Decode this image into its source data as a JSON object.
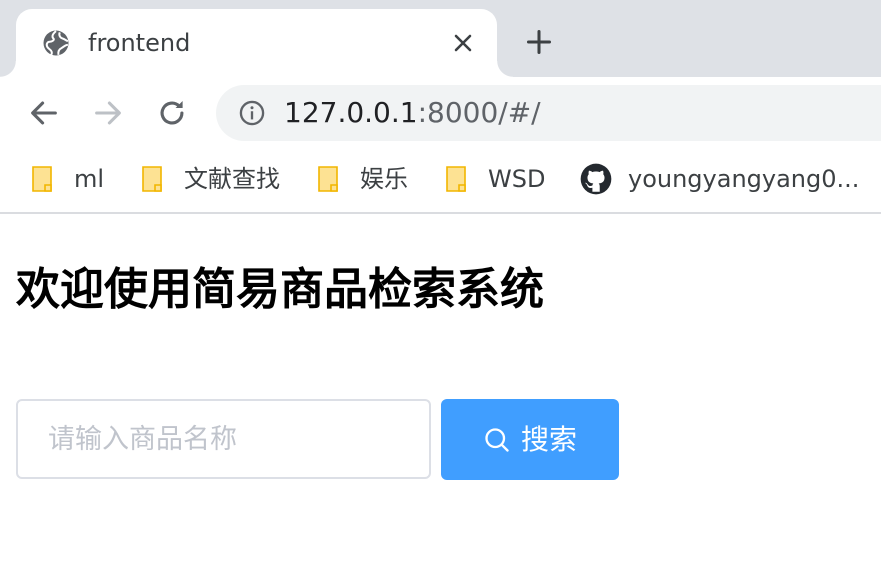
{
  "browser": {
    "tab": {
      "title": "frontend",
      "favicon": "globe-icon",
      "close_icon": "close-icon"
    },
    "new_tab_icon": "plus-icon",
    "toolbar": {
      "back_icon": "arrow-back-icon",
      "forward_icon": "arrow-forward-icon",
      "reload_icon": "reload-icon",
      "info_icon": "info-icon",
      "url_host": "127.0.0.1",
      "url_rest": ":8000/#/"
    },
    "bookmarks": [
      {
        "label": "ml",
        "icon": "folder-icon"
      },
      {
        "label": "文献查找",
        "icon": "folder-icon"
      },
      {
        "label": "娱乐",
        "icon": "folder-icon"
      },
      {
        "label": "WSD",
        "icon": "folder-icon"
      },
      {
        "label": "youngyangyang0...",
        "icon": "github-icon"
      }
    ]
  },
  "page": {
    "title": "欢迎使用简易商品检索系统",
    "search": {
      "placeholder": "请输入商品名称",
      "value": "",
      "button_label": "搜索",
      "button_icon": "search-icon",
      "button_color": "#409eff"
    }
  },
  "colors": {
    "tabstrip": "#dee1e6",
    "omnibox": "#f1f3f4",
    "folder": "#fce08a"
  }
}
